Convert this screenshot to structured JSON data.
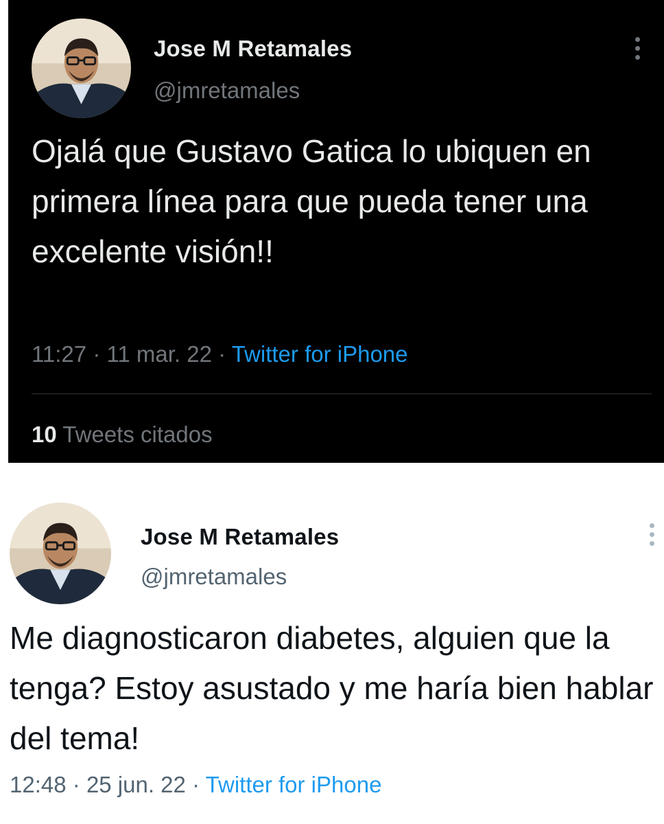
{
  "tweets": [
    {
      "theme": "dark",
      "author_name": "Jose M Retamales",
      "handle": "@jmretamales",
      "text": "Ojalá que Gustavo Gatica lo ubiquen en primera línea para que pueda tener una excelente visión!!",
      "time": "11:27",
      "separator": "·",
      "date": "11 mar. 22",
      "source": "Twitter for iPhone",
      "quote_count": "10",
      "quote_label": "Tweets citados"
    },
    {
      "theme": "light",
      "author_name": "Jose M Retamales",
      "handle": "@jmretamales",
      "text": "Me diagnosticaron diabetes, alguien que la tenga? Estoy asustado y me haría bien hablar del tema!",
      "time": "12:48",
      "separator": "·",
      "date": "25 jun. 22",
      "source": "Twitter for iPhone"
    }
  ],
  "colors": {
    "dark_background": "#000000",
    "light_background": "#ffffff",
    "link_blue": "#1d9bf0"
  },
  "icons": {
    "more_menu": "more-vertical-icon",
    "avatar": "profile-photo"
  }
}
